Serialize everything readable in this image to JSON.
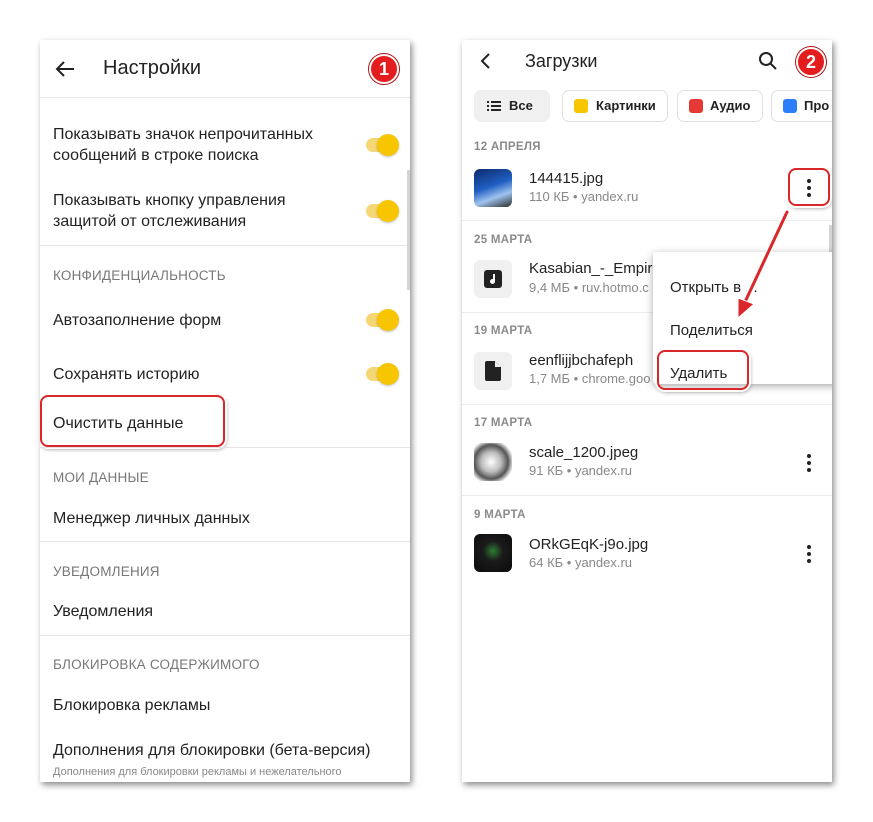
{
  "left": {
    "header": {
      "title": "Настройки",
      "badge": "1"
    },
    "rows": {
      "unread_icon": "Показывать значок непрочитанных сообщений в строке поиска",
      "tracking_button": "Показывать кнопку управления защитой от отслеживания",
      "privacy_section": "КОНФИДЕНЦИАЛЬНОСТЬ",
      "autofill": "Автозаполнение форм",
      "save_history": "Сохранять историю",
      "clear_data": "Очистить данные",
      "my_data_section": "МОИ ДАННЫЕ",
      "personal_data_manager": "Менеджер личных данных",
      "notifications_section": "УВЕДОМЛЕНИЯ",
      "notifications": "Уведомления",
      "content_block_section": "БЛОКИРОВКА СОДЕРЖИМОГО",
      "ad_block": "Блокировка рекламы",
      "block_addons": "Дополнения для блокировки (бета-версия)",
      "block_addons_sub": "Дополнения для блокировки рекламы и нежелательного"
    },
    "toggles": {
      "unread_icon": true,
      "tracking_button": true,
      "autofill": true,
      "save_history": true
    }
  },
  "right": {
    "header": {
      "title": "Загрузки",
      "badge": "2"
    },
    "chips": {
      "all": "Все",
      "pictures": "Картинки",
      "audio": "Аудио",
      "docs": "Про"
    },
    "groups": [
      {
        "date": "12 АПРЕЛЯ",
        "name": "144415.jpg",
        "meta": "110 КБ • yandex.ru"
      },
      {
        "date": "25 МАРТА",
        "name": "Kasabian_-_Empir",
        "meta": "9,4 МБ • ruv.hotmo.c"
      },
      {
        "date": "19 МАРТА",
        "name": "eenflijjbchafeph",
        "meta": "1,7 МБ • chrome.goo"
      },
      {
        "date": "17 МАРТА",
        "name": "scale_1200.jpeg",
        "meta": "91 КБ • yandex.ru"
      },
      {
        "date": "9 МАРТА",
        "name": "ORkGEqK-j9o.jpg",
        "meta": "64 КБ • yandex.ru"
      }
    ],
    "menu": {
      "open_in": "Открыть в ...",
      "share": "Поделиться",
      "delete": "Удалить"
    }
  },
  "colors": {
    "accent_yellow": "#f7c600",
    "highlight_red": "#d9272a",
    "badge_red": "#e31d1d"
  }
}
